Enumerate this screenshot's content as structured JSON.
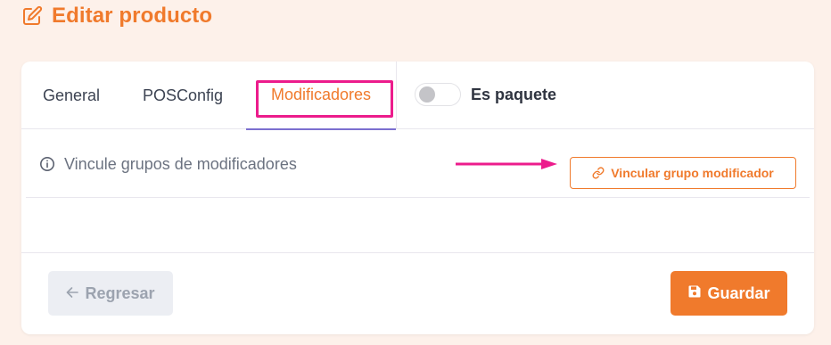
{
  "header": {
    "icon": "edit-icon",
    "title": "Editar producto"
  },
  "tabs": [
    {
      "label": "General",
      "active": false
    },
    {
      "label": "POSConfig",
      "active": false
    },
    {
      "label": "Modificadores",
      "active": true
    }
  ],
  "toggle": {
    "label": "Es paquete",
    "checked": false
  },
  "info": {
    "icon": "info-icon",
    "text": "Vincule grupos de modificadores"
  },
  "link_button": {
    "icon": "link-icon",
    "label": "Vincular grupo modificador"
  },
  "footer": {
    "back_icon": "arrow-left-icon",
    "back_label": "Regresar",
    "save_icon": "save-icon",
    "save_label": "Guardar"
  },
  "annotations": {
    "highlight_color": "#ec1c8c",
    "arrow_color": "#ec1c8c"
  },
  "colors": {
    "accent": "#f07a2c",
    "page_background": "#fdf1ea",
    "active_tab_underline": "#7c6fcf"
  }
}
